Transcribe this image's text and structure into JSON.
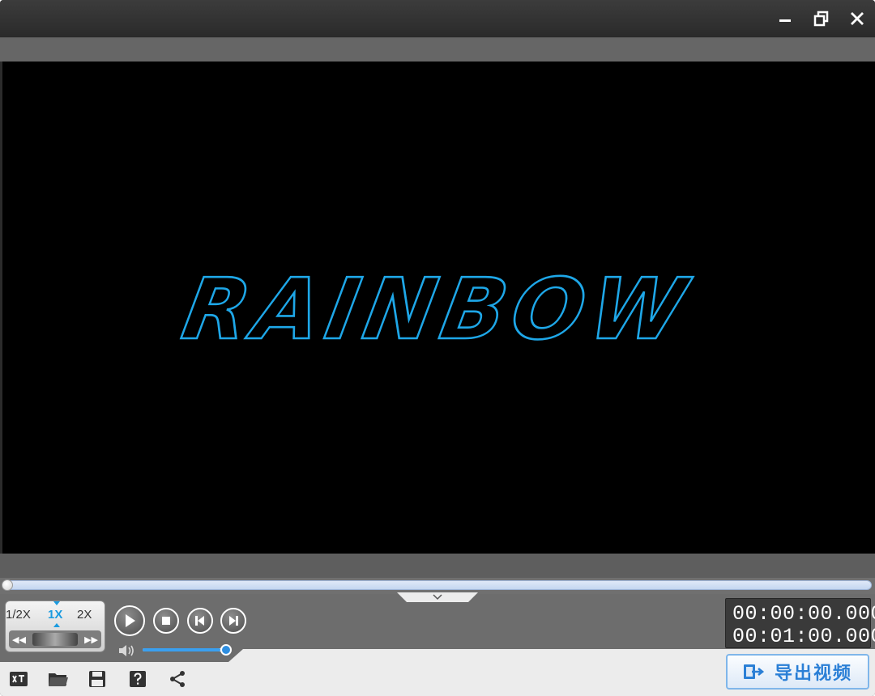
{
  "window": {
    "controls": [
      "minimize-icon",
      "restore-icon",
      "close-icon"
    ]
  },
  "preview": {
    "title_text": "RAINBOW",
    "title_color": "#1ea7e8"
  },
  "speed": {
    "options": [
      "1/2X",
      "1X",
      "2X"
    ],
    "selected": "1X"
  },
  "transport": {
    "buttons": [
      "play-icon",
      "stop-icon",
      "previous-frame-icon",
      "next-frame-icon"
    ]
  },
  "volume": {
    "level_percent": 92
  },
  "time": {
    "current": "00:00:00.000",
    "total": "00:01:00.000"
  },
  "toolbar": {
    "icons": [
      "subtitle-icon",
      "open-folder-icon",
      "save-icon",
      "help-icon",
      "share-icon"
    ]
  },
  "export": {
    "label": "导出视频"
  },
  "colors": {
    "accent": "#1a9be0",
    "export_text": "#2a7fd6",
    "panel_dark": "#6d6d6d",
    "panel_light": "#ececec"
  }
}
